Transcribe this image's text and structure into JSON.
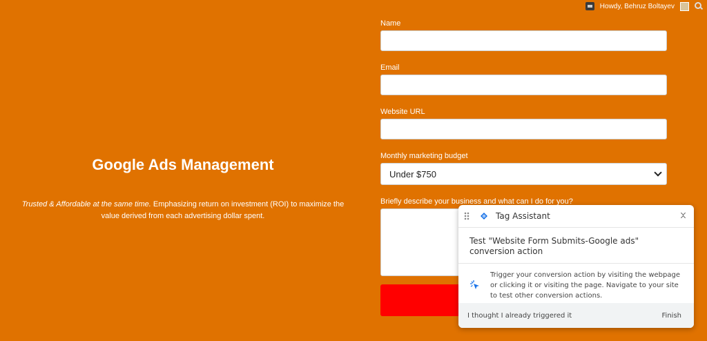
{
  "admin_bar": {
    "greeting": "Howdy, Behruz Boltayev"
  },
  "hero": {
    "title": "Google Ads Management",
    "tagline_italic": "Trusted & Affordable at the same time.",
    "tagline_rest": " Emphasizing return on investment (ROI) to maximize the value derived from each advertising dollar spent."
  },
  "form": {
    "name_label": "Name",
    "name_value": "",
    "email_label": "Email",
    "email_value": "",
    "url_label": "Website URL",
    "url_value": "",
    "budget_label": "Monthly marketing budget",
    "budget_selected": "Under $750",
    "description_label": "Briefly describe your business and what can I do for you?",
    "description_value": ""
  },
  "tag_assistant": {
    "title": "Tag Assistant",
    "subtitle": "Test \"Website Form Submits-Google ads\" conversion action",
    "body": "Trigger your conversion action by visiting the webpage or clicking it or visiting the page. Navigate to your site to test other conversion actions.",
    "footer_left": "I thought I already triggered it",
    "footer_right": "Finish"
  },
  "colors": {
    "page_background": "#e07200",
    "submit_button": "#ff0000",
    "tag_assistant_accent": "#1a73e8"
  }
}
